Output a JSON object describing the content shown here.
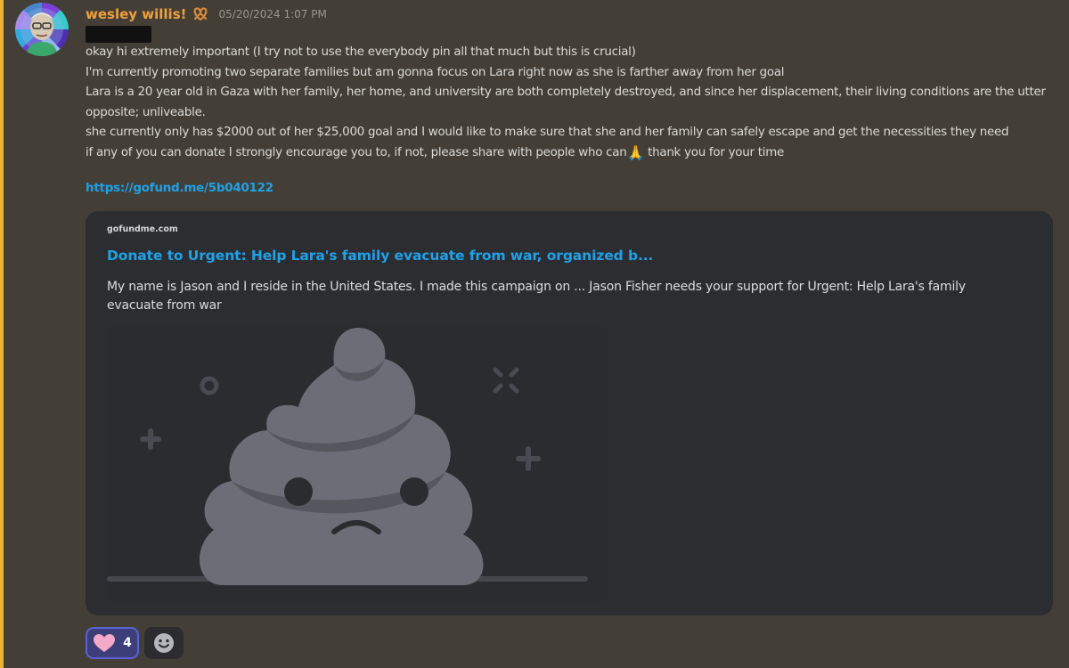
{
  "message": {
    "author": "wesley willis!",
    "role_icon": "pretzel-icon",
    "timestamp": "05/20/2024 1:07 PM",
    "lines": [
      "okay hi extremely important (I try not to use the everybody pin all that much but this is crucial)",
      "I'm currently promoting two separate families but am gonna focus on Lara right now as she is farther away from her goal",
      "Lara is a 20 year old in Gaza with her family, her home, and university are both completely destroyed, and since her displacement, their living conditions are the utter opposite; unliveable.",
      "she currently only has $2000 out of her $25,000 goal and I would like to make sure that she and her family can safely escape and get the necessities they need",
      "if any of you can donate I strongly encourage you to, if not, please share with people who can",
      " thank you for your time"
    ],
    "pray_emoji": "🙏",
    "link": "https://gofund.me/5b040122"
  },
  "embed": {
    "provider": "gofundme.com",
    "title": "Donate to Urgent: Help Lara's family evacuate from war, organized b...",
    "description": "My name is Jason and I reside in the United States. I made this campaign on ... Jason Fisher needs your support for Urgent: Help Lara's family evacuate from war",
    "image_icon": "sad-poop-placeholder-icon"
  },
  "reactions": [
    {
      "emoji": "heart-icon",
      "count": "4",
      "active": true
    }
  ],
  "colors": {
    "username": "#f3a03a",
    "link": "#1ea2e8",
    "accent_bar": "#f0b232",
    "background": "#433f37",
    "embed_bg": "#2c2d31"
  }
}
